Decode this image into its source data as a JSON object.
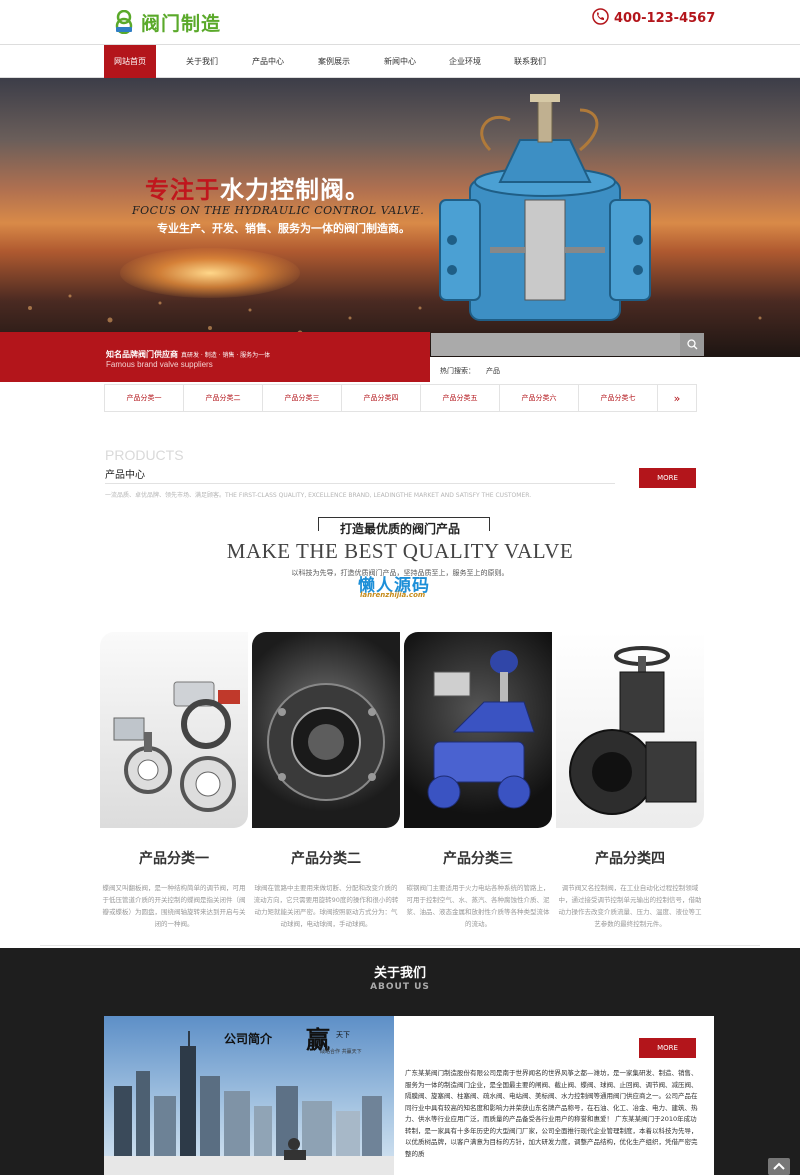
{
  "header": {
    "logo_text": "阀门制造",
    "phone": "400-123-4567"
  },
  "nav": {
    "items": [
      "网站首页",
      "关于我们",
      "产品中心",
      "案例展示",
      "新闻中心",
      "企业环境",
      "联系我们"
    ]
  },
  "banner": {
    "title_red": "专注于",
    "title_white": "水力控制阀。",
    "title_en": "FOCUS ON THE HYDRAULIC CONTROL VALVE.",
    "subtitle": "专业生产、开发、销售、服务为一体的阀门制造商。"
  },
  "promo": {
    "title": "知名品牌阀门供应商",
    "tagline": "真研发 · 制造 · 销售 · 服务为一体",
    "english": "Famous brand valve suppliers"
  },
  "search": {
    "placeholder": "",
    "hot_label": "热门搜索：",
    "hot_item": "产品"
  },
  "categories": {
    "items": [
      "产品分类一",
      "产品分类二",
      "产品分类三",
      "产品分类四",
      "产品分类五",
      "产品分类六",
      "产品分类七"
    ],
    "more": "»"
  },
  "products": {
    "title_en": "PRODUCTS",
    "title_cn": "产品中心",
    "more_label": "MORE",
    "description": "一流品质、卓优品牌、领先市场、满足顾客。THE FIRST-CLASS QUALITY, EXCELLENCE BRAND, LEADINGTHE MARKET AND SATISFY THE CUSTOMER.",
    "slogan_cn": "打造最优质的阀门产品",
    "slogan_en": "MAKE THE BEST QUALITY VALVE",
    "slogan_sub": "以科技为先导，打造优质阀门产品，坚持品质至上，服务至上的原则。",
    "watermark": "懒人源码",
    "watermark_url": "lanrenzhijia.com",
    "cards": [
      {
        "name": "产品分类一",
        "desc": "蝶阀又叫翻板阀，是一种结构简单的调节阀，可用于低压管道介质的开关控制的蝶阀是指关闭件（阀瓣或蝶板）为圆盘，围绕阀轴旋转来达到开启与关闭的一种阀。"
      },
      {
        "name": "产品分类二",
        "desc": "球阀在管路中主要用来做切断、分配和改变介质的流动方向，它只需要用旋转90度的操作和很小的转动力矩就能关闭严密。球阀按照驱动方式分为：气动球阀，电动球阀，手动球阀。"
      },
      {
        "name": "产品分类三",
        "desc": "碳钢阀门主要适用于火力电站各种系统的管路上，可用于控制空气、水、蒸汽、各种腐蚀性介质、泥浆、油品、液态金属和放射性介质等各种类型流体的流动。"
      },
      {
        "name": "产品分类四",
        "desc": "调节阀又名控制阀，在工业自动化过程控制领域中，通过接受调节控制单元输出的控制信号，借助动力操作去改变介质流量、压力、温度、液位等工艺参数的最终控制元件。"
      }
    ]
  },
  "about": {
    "title_cn": "关于我们",
    "title_en": "ABOUT US",
    "image_title": "公司简介",
    "image_char": "赢",
    "image_small": "天下",
    "image_sub": "战略合作  共赢天下",
    "more_label": "MORE",
    "text": "广东某某阀门制造股份有限公司是南于世界闻名的世界风筝之都—潍坊，是一家集研发、制造、销售、服务为一体的制造阀门企业，是全国最主要的闸阀、截止阀、蝶阀、球阀、止回阀、调节阀、减压阀、隔膜阀、旋塞阀、柱塞阀、疏水阀、电站阀、美标阀、水力控制阀等通用阀门供应商之一。公司产品在同行业中具有较高的知名度和影响力并荣获山东名牌产品称号，在石油、化工、冶金、电力、建筑、热力、供水等行业应用广泛，而质量的产品备受各行业用户的称誉和惠爱！ 广东某某阀门于2010年成功转制，是一家具有十多年历史的大型阀门厂家，公司全面推行现代企业管理制度，本着以科技为先导，以优质树品牌，以客户满意为目标的方针，加大研发力度，调整产品结构，优化生产组织，凭借严密完整的质"
  },
  "colors": {
    "brand_red": "#b3151b",
    "logo_green": "#5aa92a",
    "dark_section": "#1e1e1e"
  }
}
